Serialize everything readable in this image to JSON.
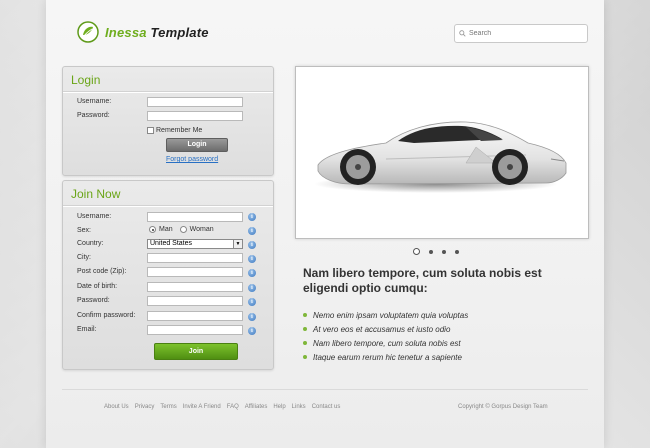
{
  "header": {
    "logo_first": "Inessa",
    "logo_second": "Template",
    "search_placeholder": "Search"
  },
  "login": {
    "title": "Login",
    "username_label": "Username:",
    "password_label": "Password:",
    "remember_label": "Remember Me",
    "login_button": "Login",
    "forgot_link": "Forgot password"
  },
  "join": {
    "title": "Join Now",
    "labels": {
      "username": "Username:",
      "sex": "Sex:",
      "country": "Country:",
      "city": "City:",
      "postcode": "Post code (Zip):",
      "dob": "Date of birth:",
      "password": "Password:",
      "confirm": "Confirm password:",
      "email": "Email:"
    },
    "sex_options": [
      "Man",
      "Woman"
    ],
    "sex_selected": "Man",
    "country_value": "United States",
    "join_button": "Join"
  },
  "slider": {
    "image": "white-sports-car",
    "slide_count": 4,
    "active_slide": 1
  },
  "content": {
    "headline": "Nam libero tempore, cum soluta nobis est eligendi optio cumqu:",
    "bullets": [
      "Nemo enim ipsam voluptatem quia voluptas",
      "At vero eos et accusamus et iusto odio",
      "Nam libero tempore, cum soluta nobis est",
      "Itaque earum rerum hic tenetur a sapiente"
    ]
  },
  "footer": {
    "links": [
      "About Us",
      "Privacy",
      "Terms",
      "Invite A Friend",
      "FAQ",
      "Affiliates",
      "Help",
      "Links",
      "Contact us"
    ],
    "copyright": "Copyright © Gorpus Design Team"
  },
  "colors": {
    "accent_green": "#6aa517",
    "link_blue": "#2870c4"
  }
}
